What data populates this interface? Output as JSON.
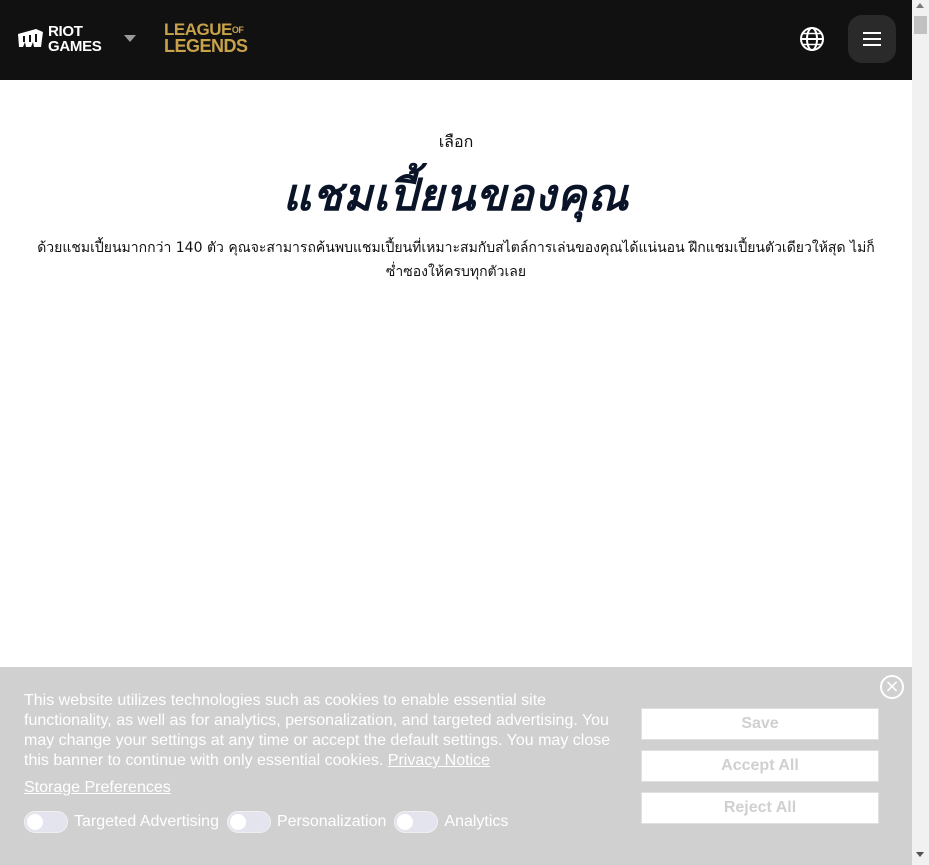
{
  "nav": {
    "riot_logo_line1": "RIOT",
    "riot_logo_line2": "GAMES",
    "lol_logo_line1": "LEAGUE",
    "lol_logo_of": "OF",
    "lol_logo_line2": "LEGENDS",
    "icons": {
      "riot": "riot-fist-icon",
      "caret": "chevron-down-icon",
      "globe": "globe-icon",
      "menu": "hamburger-menu-icon"
    }
  },
  "hero": {
    "eyebrow": "เลือก",
    "headline": "แชมเปี้ยนของคุณ",
    "description": "ด้วยแชมเปี้ยนมากกว่า 140 ตัว คุณจะสามารถค้นพบแชมเปี้ยนที่เหมาะสมกับสไตล์การเล่นของคุณได้แน่นอน ฝึกแชมเปี้ยนตัวเดียวให้สุด ไม่ก็ซ่ำซองให้ครบทุกตัวเลย"
  },
  "cookie_banner": {
    "text": "This website utilizes technologies such as cookies to enable essential site functionality, as well as for analytics, personalization, and targeted advertising. You may change your settings at any time or accept the default settings. You may close this banner to continue with only essential cookies.",
    "privacy_link": "Privacy Notice",
    "storage_link": "Storage Preferences",
    "toggles": [
      {
        "label": "Targeted Advertising",
        "on": false
      },
      {
        "label": "Personalization",
        "on": false
      },
      {
        "label": "Analytics",
        "on": false
      }
    ],
    "buttons": {
      "save": "Save",
      "accept": "Accept All",
      "reject": "Reject All"
    },
    "close_symbol": "×"
  },
  "colors": {
    "topbar": "#111111",
    "lol_gold": "#c8a24a",
    "headline": "#0a1428",
    "banner": "#d0d0d0"
  }
}
